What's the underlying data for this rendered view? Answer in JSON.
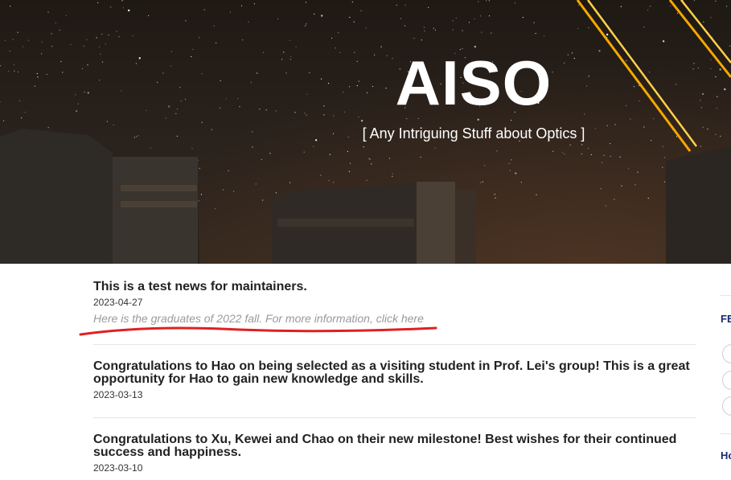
{
  "site": {
    "title": "AISO",
    "tagline": "[ Any Intriguing Stuff about Optics ]"
  },
  "news": [
    {
      "title": "This is a test news for maintainers.",
      "date": "2023-04-27",
      "summary": "Here is the graduates of 2022 fall. For more information, click here"
    },
    {
      "title": "Congratulations to Hao on being selected as a visiting student in Prof. Lei's group! This is a great opportunity for Hao to gain new knowledge and skills.",
      "date": "2023-03-13"
    },
    {
      "title": "Congratulations to Xu, Kewei and Chao on their new milestone! Best wishes for their continued success and happiness.",
      "date": "2023-03-10"
    }
  ],
  "sidebar": {
    "label_1": "FE",
    "label_2": "Ho"
  },
  "colors": {
    "annotation_line": "#e02020",
    "laser": "#f5a800",
    "sidebar_heading": "#1a2a6c"
  }
}
